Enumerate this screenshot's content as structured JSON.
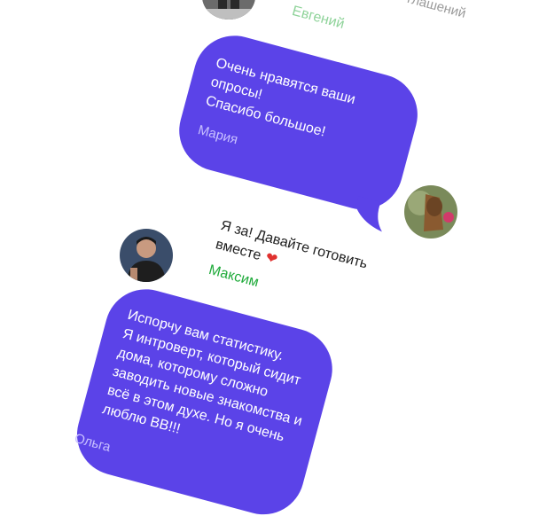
{
  "top": {
    "name": "Евгений",
    "partial_text": "глашений"
  },
  "messages": [
    {
      "text": "Очень нравятся ваши\nопросы!\nСпасибо большое!",
      "author": "Мария"
    },
    {
      "text": "Я за! Давайте готовить\nвместе",
      "emoji": "❤",
      "author": "Максим"
    },
    {
      "text": "Испорчу вам статистику.\nЯ интроверт, который сидит\nдома, которому сложно\nзаводить новые знакомства и\nвсё в этом духе. Но я очень\nлюблю ВВ!!!",
      "author": "Ольга"
    }
  ],
  "colors": {
    "bubble": "#5b43e8",
    "bubble_text": "#ffffff",
    "bubble_signature": "#c9c1ff",
    "green_name": "#1faa3a"
  }
}
